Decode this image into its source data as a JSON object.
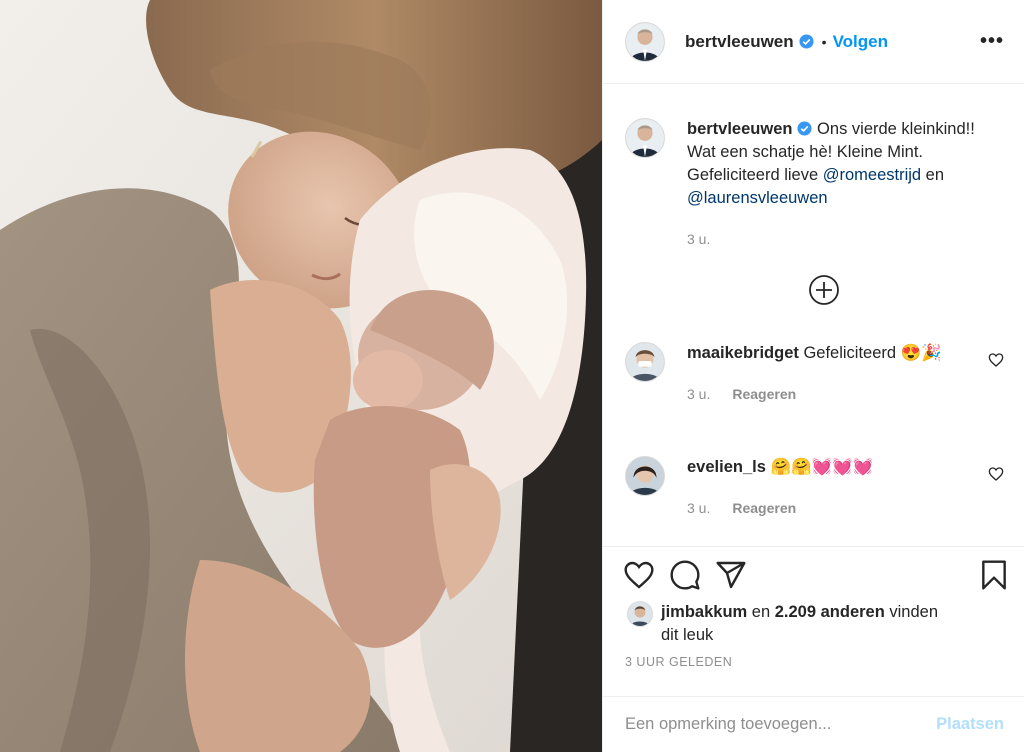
{
  "post": {
    "author": "bertvleeuwen",
    "verified": true,
    "follow_label": "Volgen",
    "more_label": "•••",
    "dot": "•"
  },
  "caption": {
    "username": "bertvleeuwen",
    "text": " Ons vierde kleinkind!! Wat een schatje hè! Kleine Mint. Gefeliciteerd lieve ",
    "mention1": "@romeestrijd",
    "joiner": " en ",
    "mention2": "@laurensvleeuwen",
    "time": "3 u."
  },
  "comments": [
    {
      "username": "maaikebridget",
      "text": " Gefeliciteerd 😍🎉",
      "time": "3 u.",
      "reply": "Reageren"
    },
    {
      "username": "evelien_ls",
      "text": " 🤗🤗💓💓💓",
      "time": "3 u.",
      "reply": "Reageren"
    }
  ],
  "likes": {
    "user": "jimbakkum",
    "middle": " en ",
    "count": "2.209 anderen",
    "suffix": " vinden dit leuk"
  },
  "timeago": "3 UUR GELEDEN",
  "add_comment": {
    "placeholder": "Een opmerking toevoegen...",
    "post_label": "Plaatsen"
  },
  "colors": {
    "link": "#0095f6",
    "post_disabled": "#b2dffc",
    "mention": "#00376b",
    "muted": "#8e8e8e"
  },
  "icons": [
    "verified-icon",
    "more-icon",
    "plus-circle-icon",
    "heart-icon",
    "comment-icon",
    "share-icon",
    "bookmark-icon"
  ]
}
